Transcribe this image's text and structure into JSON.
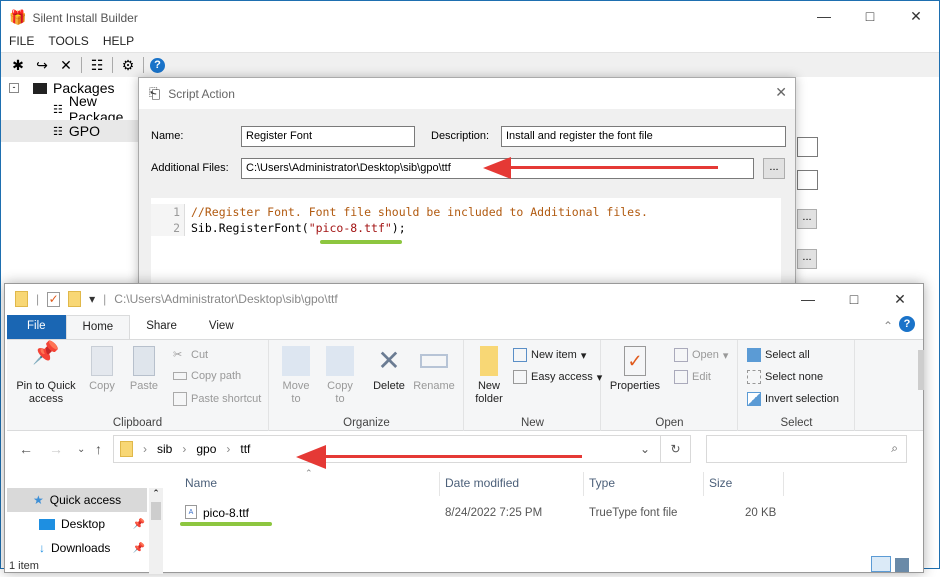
{
  "sib": {
    "title": "Silent Install Builder",
    "menu": [
      "FILE",
      "TOOLS",
      "HELP"
    ],
    "toolbar_icons": [
      "new-package-icon",
      "redo-icon",
      "delete-icon",
      "build-icon",
      "settings-icon",
      "help-icon"
    ],
    "tree": {
      "root": "Packages",
      "items": [
        "New Package",
        "GPO"
      ],
      "selected": "GPO"
    },
    "right_buttons": [
      "...",
      "..."
    ]
  },
  "dialog": {
    "title": "Script Action",
    "name_label": "Name:",
    "name_value": "Register Font",
    "description_label": "Description:",
    "description_value": "Install and register the font file",
    "files_label": "Additional Files:",
    "files_value": "C:\\Users\\Administrator\\Desktop\\sib\\gpo\\ttf",
    "browse_label": "...",
    "code": {
      "line_numbers": [
        "1",
        "2"
      ],
      "line1": "//Register Font. Font file should be included to Additional files.",
      "line2_pre": "Sib.RegisterFont(",
      "line2_str": "\"pico-8.ttf\"",
      "line2_post": ");"
    }
  },
  "explorer": {
    "title_path": "C:\\Users\\Administrator\\Desktop\\sib\\gpo\\ttf",
    "tabs": [
      "File",
      "Home",
      "Share",
      "View"
    ],
    "active_tab": "Home",
    "ribbon": {
      "clipboard": {
        "label": "Clipboard",
        "pin": "Pin to Quick access",
        "copy": "Copy",
        "paste": "Paste",
        "cut": "Cut",
        "copy_path": "Copy path",
        "paste_shortcut": "Paste shortcut"
      },
      "organize": {
        "label": "Organize",
        "move_to": "Move to",
        "copy_to": "Copy to",
        "delete": "Delete",
        "rename": "Rename"
      },
      "new": {
        "label": "New",
        "new_folder": "New folder",
        "new_item": "New item",
        "easy_access": "Easy access"
      },
      "open": {
        "label": "Open",
        "properties": "Properties",
        "open": "Open",
        "edit": "Edit"
      },
      "select": {
        "label": "Select",
        "select_all": "Select all",
        "select_none": "Select none",
        "invert": "Invert selection"
      }
    },
    "breadcrumb": [
      "sib",
      "gpo",
      "ttf"
    ],
    "search_placeholder": "",
    "nav": [
      "Quick access",
      "Desktop",
      "Downloads"
    ],
    "columns": [
      "Name",
      "Date modified",
      "Type",
      "Size"
    ],
    "files": [
      {
        "name": "pico-8.ttf",
        "date": "8/24/2022 7:25 PM",
        "type": "TrueType font file",
        "size": "20 KB"
      }
    ],
    "status": "1 item"
  },
  "colors": {
    "file_tab": "#1a66b3",
    "annotation_arrow": "#e53935",
    "annotation_underline": "#8dc63f",
    "help_blue": "#1a73c9"
  }
}
